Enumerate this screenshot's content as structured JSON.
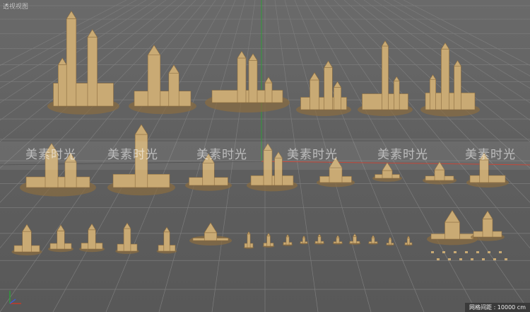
{
  "viewport": {
    "title": "透视视图",
    "status": "网格间距 : 10000 cm"
  },
  "watermark": {
    "text": "美素时光"
  },
  "colors": {
    "background": "#606060",
    "grid_line": "#7c7c7c",
    "model": "#c9aa74",
    "model_shadow": "#8a6c40",
    "axis_x": "#c03a2a",
    "axis_y": "#2f9c3a",
    "axis_z": "#3c5ed0"
  },
  "icons": {
    "axis_gizmo": "xyz-axis-icon"
  }
}
